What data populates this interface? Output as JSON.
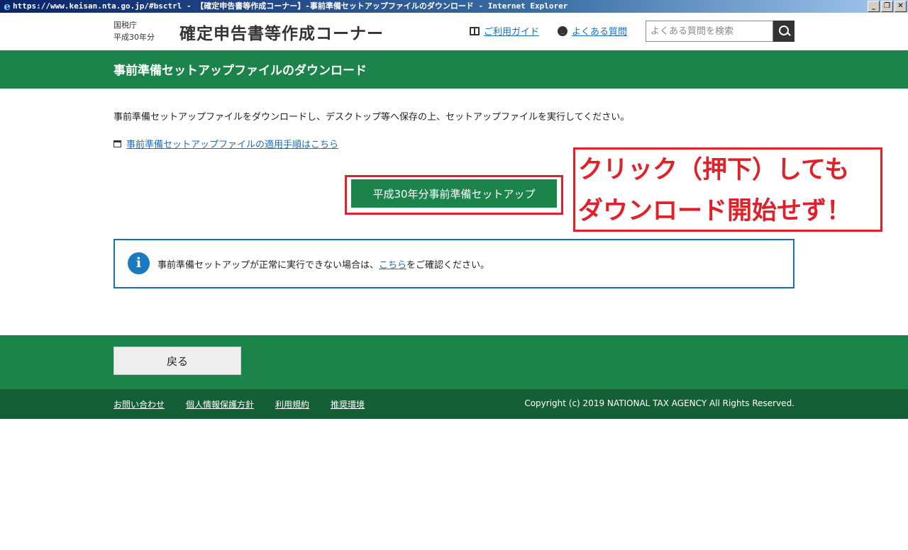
{
  "window": {
    "title": "https://www.keisan.nta.go.jp/#bsctrl - 【確定申告書等作成コーナー】-事前準備セットアップファイルのダウンロード - Internet Explorer",
    "minimize": "_",
    "restore": "❐",
    "close": "✕"
  },
  "header": {
    "agency_line1": "国税庁",
    "agency_line2": "平成30年分",
    "site_title": "確定申告書等作成コーナー",
    "guide_link": "ご利用ガイド",
    "faq_link": "よくある質問",
    "search_placeholder": "よくある質問を検索"
  },
  "banner": {
    "title": "事前準備セットアップファイルのダウンロード"
  },
  "main": {
    "intro": "事前準備セットアップファイルをダウンロードし、デスクトップ等へ保存の上、セットアップファイルを実行してください。",
    "procedure_link": "事前準備セットアップファイルの適用手順はこちら",
    "setup_button": "平成30年分事前準備セットアップ",
    "info_prefix": "事前準備セットアップが正常に実行できない場合は、",
    "info_link": "こちら",
    "info_suffix": "をご確認ください。"
  },
  "annotation": {
    "line1": "クリック（押下）しても",
    "line2": "ダウンロード開始せず！"
  },
  "footer": {
    "back_button": "戻る",
    "links": [
      "お問い合わせ",
      "個人情報保護方針",
      "利用規約",
      "推奨環境"
    ],
    "copyright": "Copyright (c) 2019 NATIONAL TAX AGENCY All Rights Reserved."
  },
  "colors": {
    "green": "#1c844b",
    "dark_green": "#155f36",
    "annotation_red": "#e0202a",
    "link_blue": "#1a6fb5"
  }
}
